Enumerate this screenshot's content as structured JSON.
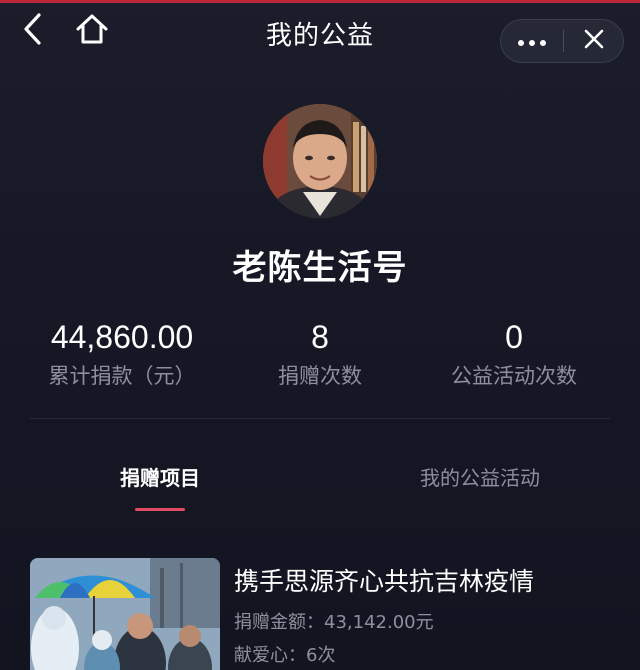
{
  "header": {
    "title": "我的公益",
    "back_icon": "chevron-left-icon",
    "home_icon": "home-icon",
    "more_icon": "more-dots-icon",
    "close_icon": "close-icon"
  },
  "profile": {
    "name": "老陈生活号"
  },
  "stats": [
    {
      "value": "44,860.00",
      "label": "累计捐款（元）"
    },
    {
      "value": "8",
      "label": "捐赠次数"
    },
    {
      "value": "0",
      "label": "公益活动次数"
    }
  ],
  "tabs": [
    {
      "label": "捐赠项目",
      "active": true
    },
    {
      "label": "我的公益活动",
      "active": false
    }
  ],
  "projects": [
    {
      "title": "携手思源齐心共抗吉林疫情",
      "amount_line": "捐赠金额：43,142.00元",
      "count_line": "献爱心：6次"
    }
  ],
  "colors": {
    "background": "#141622",
    "accent": "#e04a62",
    "muted_text": "#8d909c"
  }
}
